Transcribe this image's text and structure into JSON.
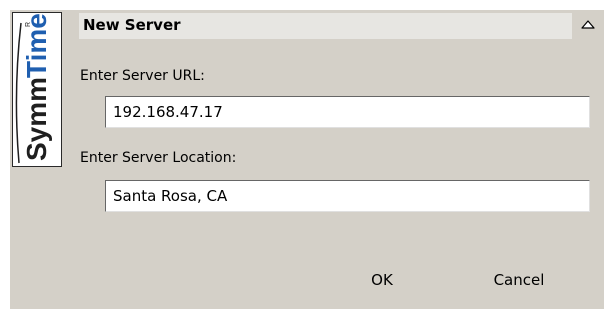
{
  "dialog": {
    "title": "New Server",
    "brand_logo_text": "SymmTime",
    "url_label": "Enter Server URL:",
    "url_value": "192.168.47.17",
    "location_label": "Enter Server Location:",
    "location_value": "Santa Rosa, CA",
    "ok_label": "OK",
    "cancel_label": "Cancel",
    "collapse_icon": "collapse-up-icon"
  },
  "colors": {
    "dialog_background": "#d4d0c8",
    "title_bar_background": "#e7e6e2",
    "logo_dark": "#1f1f1f",
    "logo_accent_blue": "#1f5fb0"
  }
}
